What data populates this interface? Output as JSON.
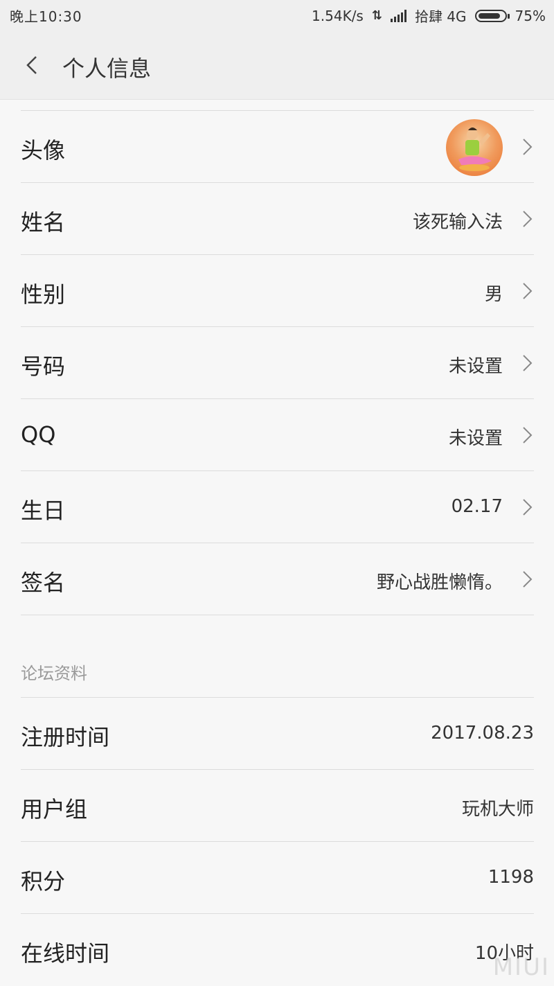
{
  "status_bar": {
    "time": "晚上10:30",
    "net_speed": "1.54K/s",
    "carrier": "拾肆 4G",
    "battery_percent": "75%",
    "battery_level": 0.75
  },
  "header": {
    "title": "个人信息",
    "back_icon": "chevron-left-icon"
  },
  "profile_rows": [
    {
      "label": "头像",
      "value": ""
    },
    {
      "label": "姓名",
      "value": "该死输入法"
    },
    {
      "label": "性别",
      "value": "男"
    },
    {
      "label": "号码",
      "value": "未设置"
    },
    {
      "label": "QQ",
      "value": "未设置"
    },
    {
      "label": "生日",
      "value": "02.17"
    },
    {
      "label": "签名",
      "value": "野心战胜懒惰。"
    }
  ],
  "forum_section": {
    "title": "论坛资料",
    "rows": [
      {
        "label": "注册时间",
        "value": "2017.08.23"
      },
      {
        "label": "用户组",
        "value": "玩机大师"
      },
      {
        "label": "积分",
        "value": "1198"
      },
      {
        "label": "在线时间",
        "value": "10小时"
      }
    ]
  },
  "watermark": "MIUI",
  "colors": {
    "background": "#f7f7f7",
    "header": "#efefef",
    "divider": "#dcdcdc",
    "section_title": "#9a9a9a"
  }
}
